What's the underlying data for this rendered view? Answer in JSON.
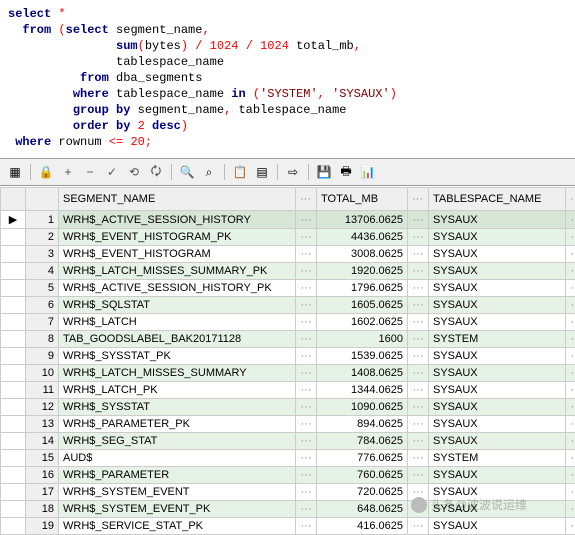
{
  "sql": {
    "raw": "select *\n  from (select segment_name,\n               sum(bytes) / 1024 / 1024 total_mb,\n               tablespace_name\n          from dba_segments\n         where tablespace_name in ('SYSTEM', 'SYSAUX')\n         group by segment_name, tablespace_name\n         order by 2 desc)\n where rownum <= 20;"
  },
  "toolbar": {
    "grid_icon": "▦",
    "lock_icon": "🔒",
    "add_icon": "+",
    "remove_icon": "−",
    "commit_icon": "✓",
    "post_icon": "⟲",
    "refresh_icon": "🗘",
    "find_icon": "🔍",
    "filter_icon": "⌕",
    "copy_icon": "📋",
    "goto_icon": "▤",
    "export_icon": "⇨",
    "save_icon": "💾",
    "print_icon": "🖶",
    "chart_icon": "📊"
  },
  "columns": {
    "segment_name": "SEGMENT_NAME",
    "total_mb": "TOTAL_MB",
    "tablespace_name": "TABLESPACE_NAME",
    "dots": "···"
  },
  "rows": [
    {
      "n": 1,
      "segment_name": "WRH$_ACTIVE_SESSION_HISTORY",
      "total_mb": "13706.0625",
      "tablespace_name": "SYSAUX",
      "selected": true
    },
    {
      "n": 2,
      "segment_name": "WRH$_EVENT_HISTOGRAM_PK",
      "total_mb": "4436.0625",
      "tablespace_name": "SYSAUX"
    },
    {
      "n": 3,
      "segment_name": "WRH$_EVENT_HISTOGRAM",
      "total_mb": "3008.0625",
      "tablespace_name": "SYSAUX"
    },
    {
      "n": 4,
      "segment_name": "WRH$_LATCH_MISSES_SUMMARY_PK",
      "total_mb": "1920.0625",
      "tablespace_name": "SYSAUX"
    },
    {
      "n": 5,
      "segment_name": "WRH$_ACTIVE_SESSION_HISTORY_PK",
      "total_mb": "1796.0625",
      "tablespace_name": "SYSAUX"
    },
    {
      "n": 6,
      "segment_name": "WRH$_SQLSTAT",
      "total_mb": "1605.0625",
      "tablespace_name": "SYSAUX"
    },
    {
      "n": 7,
      "segment_name": "WRH$_LATCH",
      "total_mb": "1602.0625",
      "tablespace_name": "SYSAUX"
    },
    {
      "n": 8,
      "segment_name": "TAB_GOODSLABEL_BAK20171128",
      "total_mb": "1600",
      "tablespace_name": "SYSTEM"
    },
    {
      "n": 9,
      "segment_name": "WRH$_SYSSTAT_PK",
      "total_mb": "1539.0625",
      "tablespace_name": "SYSAUX"
    },
    {
      "n": 10,
      "segment_name": "WRH$_LATCH_MISSES_SUMMARY",
      "total_mb": "1408.0625",
      "tablespace_name": "SYSAUX"
    },
    {
      "n": 11,
      "segment_name": "WRH$_LATCH_PK",
      "total_mb": "1344.0625",
      "tablespace_name": "SYSAUX"
    },
    {
      "n": 12,
      "segment_name": "WRH$_SYSSTAT",
      "total_mb": "1090.0625",
      "tablespace_name": "SYSAUX"
    },
    {
      "n": 13,
      "segment_name": "WRH$_PARAMETER_PK",
      "total_mb": "894.0625",
      "tablespace_name": "SYSAUX"
    },
    {
      "n": 14,
      "segment_name": "WRH$_SEG_STAT",
      "total_mb": "784.0625",
      "tablespace_name": "SYSAUX"
    },
    {
      "n": 15,
      "segment_name": "AUD$",
      "total_mb": "776.0625",
      "tablespace_name": "SYSTEM"
    },
    {
      "n": 16,
      "segment_name": "WRH$_PARAMETER",
      "total_mb": "760.0625",
      "tablespace_name": "SYSAUX"
    },
    {
      "n": 17,
      "segment_name": "WRH$_SYSTEM_EVENT",
      "total_mb": "720.0625",
      "tablespace_name": "SYSAUX"
    },
    {
      "n": 18,
      "segment_name": "WRH$_SYSTEM_EVENT_PK",
      "total_mb": "648.0625",
      "tablespace_name": "SYSAUX"
    },
    {
      "n": 19,
      "segment_name": "WRH$_SERVICE_STAT_PK",
      "total_mb": "416.0625",
      "tablespace_name": "SYSAUX"
    }
  ],
  "watermark": {
    "text": "头条@波波说运维"
  }
}
